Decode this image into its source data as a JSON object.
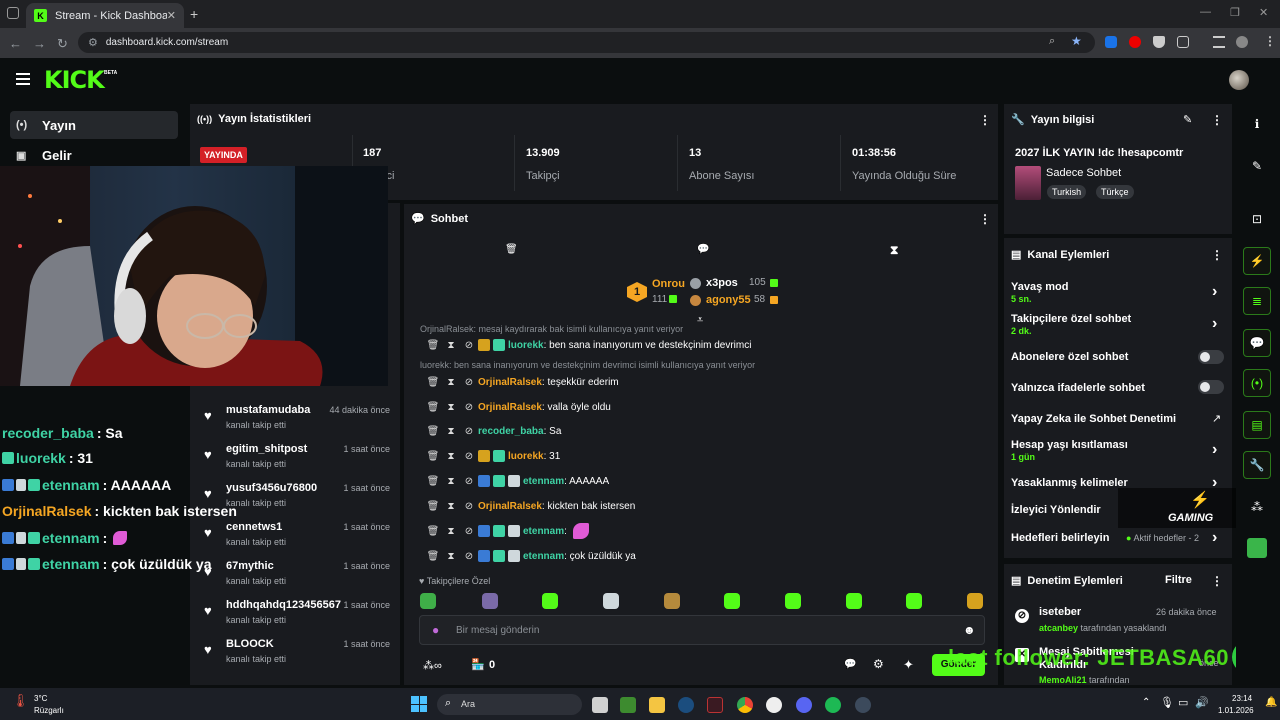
{
  "browser": {
    "tab_title": "Stream - Kick Dashboard",
    "tab_favicon": "K",
    "url": "dashboard.kick.com/stream"
  },
  "kick": {
    "logo": "KICK",
    "beta": "BETA"
  },
  "sidebar": {
    "items": [
      {
        "label": "Yayın",
        "icon": "live-icon"
      },
      {
        "label": "Gelir",
        "icon": "revenue-icon"
      }
    ]
  },
  "stats": {
    "title": "Yayın İstatistikleri",
    "live_badge": "YAYINDA",
    "viewers_value": "187",
    "viewers_label_partial": "ici",
    "followers_value": "13.909",
    "followers_label": "Takipçi",
    "subs_value": "13",
    "subs_label": "Abone Sayısı",
    "uptime_value": "01:38:56",
    "uptime_label": "Yayında Olduğu Süre"
  },
  "stream_info": {
    "title": "Yayın bilgisi",
    "stream_title": "2027 İLK YAYIN !dc !hesapcomtr",
    "category": "Sadece Sohbet",
    "tags": [
      "Turkish",
      "Türkçe"
    ]
  },
  "overlay_chat": [
    {
      "user": "recoder_baba",
      "msg": ": Sa",
      "color": "#3fd3a5",
      "partial": true
    },
    {
      "user": "luorekk",
      "msg": ": 31",
      "color": "#3fd3a5"
    },
    {
      "user": "etennam",
      "msg": ": AAAAAA",
      "color": "#3fd3a5"
    },
    {
      "user": "OrjinalRalsek",
      "msg": ": kickten bak istersen",
      "color": "#f5a623"
    },
    {
      "user": "etennam",
      "msg": ":",
      "color": "#3fd3a5"
    },
    {
      "user": "etennam",
      "msg": ": çok üzüldük ya",
      "color": "#3fd3a5"
    }
  ],
  "follows": [
    {
      "name": "mustafamudaba",
      "sub": "kanalı takip etti",
      "time": "44 dakika önce"
    },
    {
      "name": "egitim_shitpost",
      "sub": "kanalı takip etti",
      "time": "1 saat önce"
    },
    {
      "name": "yusuf3456u76800",
      "sub": "kanalı takip etti",
      "time": "1 saat önce"
    },
    {
      "name": "cennetws1",
      "sub": "kanalı takip etti",
      "time": "1 saat önce"
    },
    {
      "name": "67mythic",
      "sub": "kanalı takip etti",
      "time": "1 saat önce"
    },
    {
      "name": "hddhqahdq123456567",
      "sub": "kanalı takip etti",
      "time": "1 saat önce"
    },
    {
      "name": "BLOOCK",
      "sub": "kanalı takip etti",
      "time": "1 saat önce"
    }
  ],
  "chat": {
    "title": "Sohbet",
    "leaderboard": {
      "first": {
        "rank": "1",
        "name": "Onrou",
        "value": "111"
      },
      "second": {
        "name": "x3pos",
        "value": "105"
      },
      "third": {
        "name": "agony55",
        "value": "58"
      }
    },
    "reply_top": "OrjinalRalsek: mesaj kaydırarak bak isimli kullanıcıya yanıt veriyor",
    "reply_mid": "luorekk: ben sana inanıyorum ve destekçinim devrimci isimli kullanıcıya yanıt veriyor",
    "messages": [
      {
        "user": "luorekk",
        "text": ": ben sana inanıyorum ve destekçinim devrimci",
        "style": "green"
      },
      {
        "user": "OrjinalRalsek",
        "text": ": teşekkür ederim",
        "style": "orange"
      },
      {
        "user": "OrjinalRalsek",
        "text": ": valla öyle oldu",
        "style": "orange"
      },
      {
        "user": "recoder_baba",
        "text": ": Sa",
        "style": "green"
      },
      {
        "user": "luorekk",
        "text": ": 31",
        "style": "orange"
      },
      {
        "user": "etennam",
        "text": ": AAAAAA",
        "style": "green"
      },
      {
        "user": "OrjinalRalsek",
        "text": ": kickten bak istersen",
        "style": "orange"
      },
      {
        "user": "etennam",
        "text": ":",
        "style": "green"
      },
      {
        "user": "etennam",
        "text": ": çok üzüldük ya",
        "style": "green"
      }
    ],
    "followers_only": "Takipçilere Özel",
    "input_placeholder": "Bir mesaj gönderin",
    "counter": "0",
    "send_label": "Gönder"
  },
  "channel_actions": {
    "title": "Kanal Eylemleri",
    "slow_mode": "Yavaş mod",
    "slow_mode_value": "5 sn.",
    "followers_chat": "Takipçilere özel sohbet",
    "followers_chat_value": "2 dk.",
    "subs_chat": "Abonelere özel sohbet",
    "emote_chat": "Yalnızca ifadelerle sohbet",
    "ai_moderation": "Yapay Zeka ile Sohbet Denetimi",
    "age_restriction": "Hesap yaşı kısıtlaması",
    "age_value": "1 gün",
    "banned_words": "Yasaklanmış kelimeler",
    "viewer_redirect": "İzleyici Yönlendir",
    "goals": "Hedefleri belirleyin",
    "goals_status": "Aktif hedefler - 2"
  },
  "mod_actions": {
    "title": "Denetim Eylemleri",
    "filter": "Filtre",
    "entries": [
      {
        "user": "iseteber",
        "time": "26 dakika önce",
        "detail_user": "atcanbey",
        "detail": "tarafından yasaklandı"
      },
      {
        "user": "Mesaj Sabitlemesi Kaldırıldı",
        "time": "önce",
        "detail_user": "MemoAli21",
        "detail": "tarafından"
      }
    ]
  },
  "overlay_text": {
    "watermark": "GAMING",
    "last_follower": "last follower: JETBASA60"
  },
  "taskbar": {
    "weather_temp": "3°C",
    "weather_desc": "Rüzgarlı",
    "search": "Ara",
    "time": "23:14",
    "date": "1.01.2026"
  },
  "colors": {
    "accent": "#53fc18",
    "live_red": "#d42027",
    "username_orange": "#f5a623",
    "username_green": "#3fd3a5",
    "panel_bg": "#191b1f"
  }
}
